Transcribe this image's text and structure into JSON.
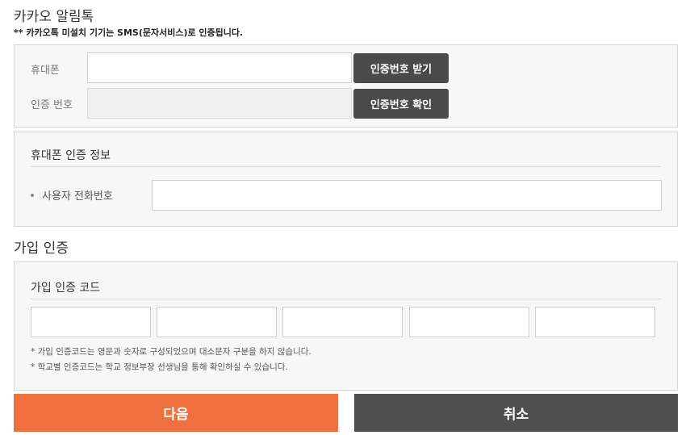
{
  "kakao": {
    "title": "카카오 알림톡",
    "note": "** 카카오톡 미설치 기기는 SMS(문자서비스)로 인증됩니다.",
    "phone_label": "휴대폰",
    "phone_value": "",
    "get_code_button": "인증번호 받기",
    "code_label": "인증 번호",
    "code_value": "",
    "confirm_button": "인증번호 확인"
  },
  "phone_info": {
    "heading": "휴대폰 인증 정보",
    "user_phone_label": "사용자 전화번호",
    "user_phone_value": ""
  },
  "signup": {
    "title": "가입 인증",
    "heading": "가입 인증 코드",
    "code_inputs": [
      "",
      "",
      "",
      "",
      ""
    ],
    "notes": [
      "* 가입 인증코드는 영문과 숫자로 구성되었으며 대소문자 구분을 하지 않습니다.",
      "* 학교별 인증코드는 학교 정보부장 선생님을 통해 확인하실 수 있습니다."
    ]
  },
  "actions": {
    "next_label": "다음",
    "cancel_label": "취소",
    "next_color": "#ef6f3d",
    "cancel_color": "#4f4f4f"
  }
}
